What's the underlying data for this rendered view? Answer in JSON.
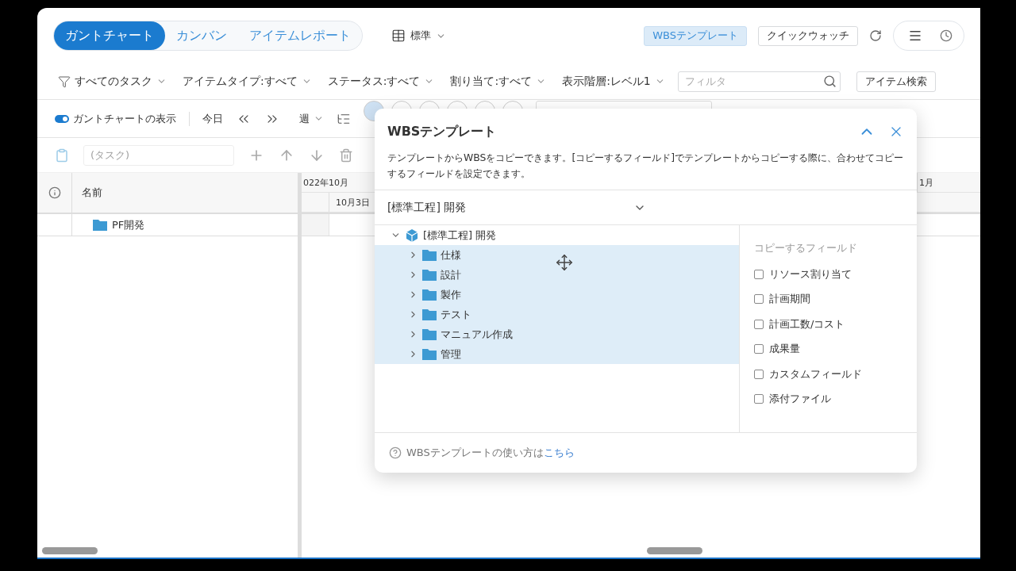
{
  "view_tabs": [
    {
      "label": "ガントチャート",
      "selected": true
    },
    {
      "label": "カンバン",
      "selected": false
    },
    {
      "label": "アイテムレポート",
      "selected": false
    }
  ],
  "layout_menu": {
    "label": "標準"
  },
  "header_buttons": [
    {
      "label": "WBSテンプレート",
      "selected": true
    },
    {
      "label": "クイックウォッチ",
      "selected": false
    }
  ],
  "filters": [
    {
      "label": "すべてのタスク",
      "kind": "main"
    },
    {
      "label": "アイテムタイプ:すべて",
      "kind": "dropdown"
    },
    {
      "label": "ステータス:すべて",
      "kind": "dropdown"
    },
    {
      "label": "割り当て:すべて",
      "kind": "dropdown"
    },
    {
      "label": "表示階層:レベル1",
      "kind": "dropdown"
    }
  ],
  "filter_field": {
    "placeholder": "フィルタ"
  },
  "item_search": {
    "label": "アイテム検索"
  },
  "gantt_toolbar": {
    "gantt_toggle": {
      "label": "ガントチャートの表示",
      "on": true
    },
    "today": "今日",
    "scale": "週"
  },
  "edit_toolbar": {
    "disabled": true,
    "task_field": {
      "placeholder": "(タスク)"
    }
  },
  "grid": {
    "columns": [
      {
        "label": "名前"
      }
    ],
    "rows": [
      {
        "name": "PF開発"
      }
    ]
  },
  "timeline": {
    "months": [
      "022年10月",
      "1月"
    ],
    "days": [
      "10月3日"
    ]
  },
  "dialog": {
    "title": "WBSテンプレート",
    "description": "テンプレートからWBSをコピーできます。[コピーするフィールド]でテンプレートからコピーする際に、合わせてコピーするフィールドを設定できます。",
    "template_select": {
      "value": "[標準工程] 開発"
    },
    "tree": {
      "label": "[標準工程] 開発",
      "expanded": true,
      "selected": false,
      "children": [
        {
          "label": "仕様",
          "expanded": false,
          "selected": true
        },
        {
          "label": "設計",
          "expanded": false,
          "selected": true
        },
        {
          "label": "製作",
          "expanded": false,
          "selected": true
        },
        {
          "label": "テスト",
          "expanded": false,
          "selected": true
        },
        {
          "label": "マニュアル作成",
          "expanded": false,
          "selected": true
        },
        {
          "label": "管理",
          "expanded": false,
          "selected": true
        }
      ]
    },
    "copy_fields": {
      "title": "コピーするフィールド",
      "items": [
        {
          "label": "リソース割り当て",
          "checked": false
        },
        {
          "label": "計画期間",
          "checked": false
        },
        {
          "label": "計画工数/コスト",
          "checked": false
        },
        {
          "label": "成果量",
          "checked": false
        },
        {
          "label": "カスタムフィールド",
          "checked": false
        },
        {
          "label": "添付ファイル",
          "checked": false
        }
      ]
    },
    "help": {
      "text": "WBSテンプレートの使い方は",
      "link": "こちら"
    }
  }
}
